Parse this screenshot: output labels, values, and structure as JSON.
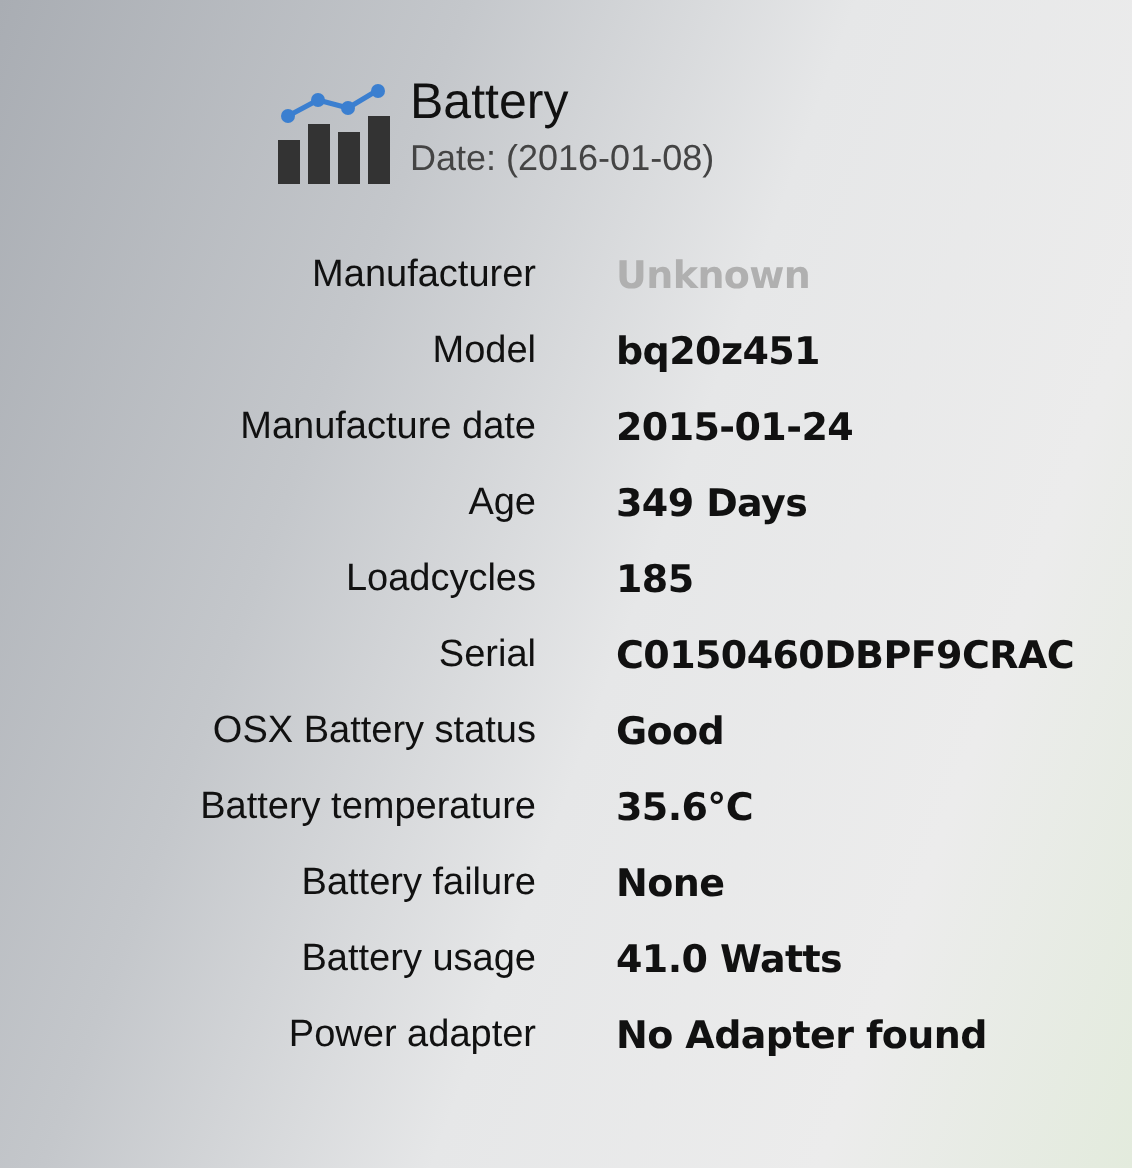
{
  "header": {
    "title": "Battery",
    "subtitle": "Date: (2016-01-08)"
  },
  "rows": [
    {
      "label": "Manufacturer",
      "value": "Unknown",
      "dimmed": true
    },
    {
      "label": "Model",
      "value": "bq20z451",
      "dimmed": false
    },
    {
      "label": "Manufacture date",
      "value": "2015-01-24",
      "dimmed": false
    },
    {
      "label": "Age",
      "value": "349 Days",
      "dimmed": false
    },
    {
      "label": "Loadcycles",
      "value": "185",
      "dimmed": false
    },
    {
      "label": "Serial",
      "value": "C0150460DBPF9CRAC",
      "dimmed": false
    },
    {
      "label": "OSX Battery status",
      "value": "Good",
      "dimmed": false
    },
    {
      "label": "Battery temperature",
      "value": "35.6°C",
      "dimmed": false
    },
    {
      "label": "Battery failure",
      "value": "None",
      "dimmed": false
    },
    {
      "label": "Battery usage",
      "value": "41.0 Watts",
      "dimmed": false
    },
    {
      "label": "Power adapter",
      "value": "No Adapter found",
      "dimmed": false
    }
  ]
}
